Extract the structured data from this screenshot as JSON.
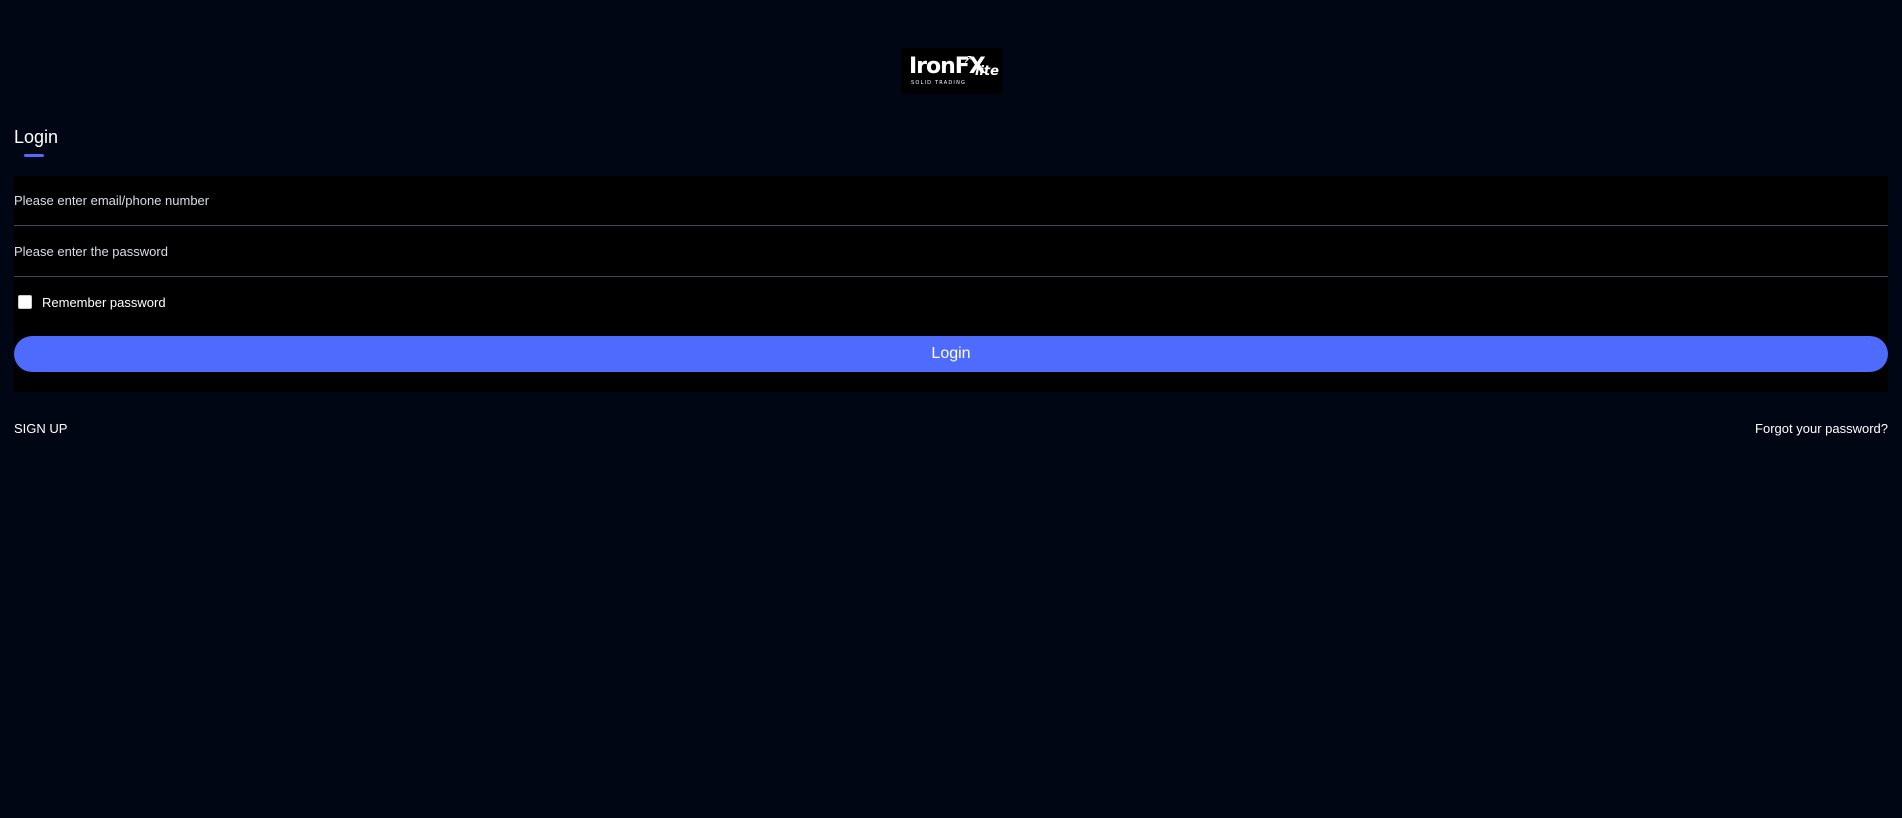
{
  "brand": {
    "logo_text": "IronFX",
    "logo_suffix": "lite",
    "logo_tagline": "SOLID TRADING"
  },
  "login_tab": {
    "title": "Login"
  },
  "form": {
    "email_placeholder": "Please enter email/phone number",
    "email_value": "",
    "password_placeholder": "Please enter the password",
    "password_value": "",
    "remember_label": "Remember password",
    "remember_checked": false,
    "login_button_label": "Login"
  },
  "footer": {
    "signup_label": "SIGN UP",
    "forgot_label": "Forgot your password?"
  },
  "colors": {
    "background": "#010614",
    "panel": "#000000",
    "accent": "#4f6bfe",
    "divider": "#3a4866"
  },
  "icons": {
    "logo_arrow": "arrow-up-right-icon"
  }
}
